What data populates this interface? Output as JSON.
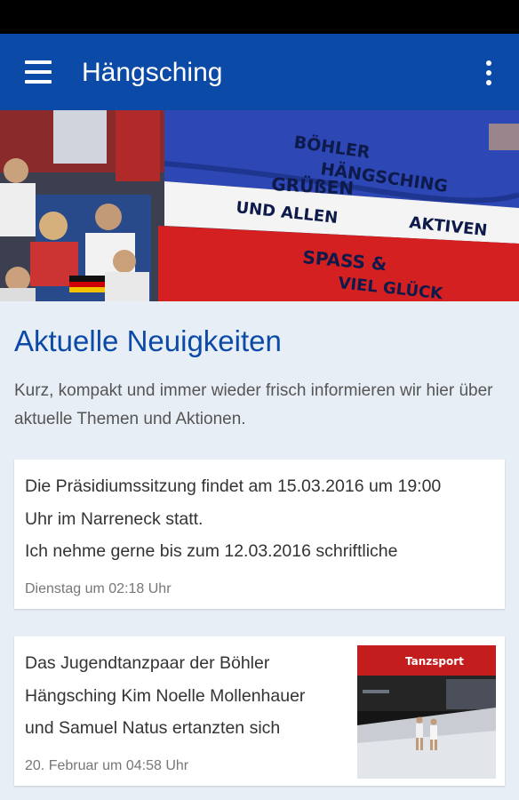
{
  "app_bar": {
    "title": "Hängsching",
    "menu_icon": "hamburger-menu-icon",
    "overflow_icon": "more-vert-icon",
    "color": "#0b4aa6"
  },
  "hero_banner": {
    "flag_text_lines": [
      "BÖHLER",
      "HÄNGSCHING",
      "GRÜßEN",
      "UND ALLEN",
      "AKTIVEN",
      "SPASS &",
      "VIEL GLÜCK"
    ]
  },
  "news": {
    "title": "Aktuelle Neuigkeiten",
    "description": "Kurz, kompakt und immer wieder frisch informieren wir hier über aktuelle Themen und Aktionen.",
    "items": [
      {
        "line1": "Die Präsidiumssitzung findet am 15.03.2016 um 19:00",
        "line2": "Uhr im Narreneck statt.",
        "line3": "Ich nehme gerne bis zum 12.03.2016 schriftliche",
        "date": "Dienstag um 02:18 Uhr"
      },
      {
        "line1": "Das Jugendtanzpaar der Böhler",
        "line2": "Hängsching Kim Noelle Mollenhauer",
        "line3": "und Samuel Natus ertanzten sich",
        "date": "20. Februar um 04:58 Uhr",
        "thumb_banner_text": "Tanzsport"
      }
    ]
  }
}
